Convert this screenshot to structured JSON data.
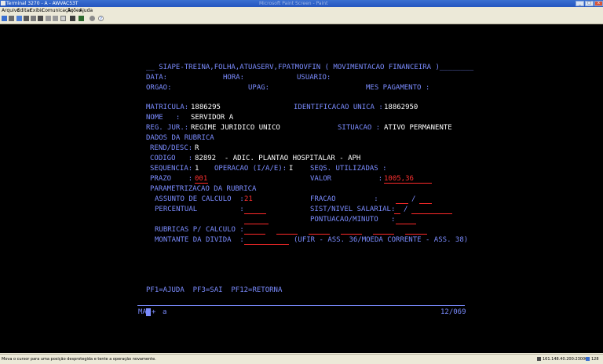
{
  "window": {
    "title": "Terminal 3270 - A - AWVAC53T",
    "ghost_title": "Microsoft Paint Screen - Paint"
  },
  "menu": [
    "Arquivo",
    "Editar",
    "Exibir",
    "Comunicação",
    "Ações",
    "Ajuda"
  ],
  "screen": {
    "header": "__ SIAPE-TREINA,FOLHA,ATUASERV,FPATMOVFIN ( MOVIMENTACAO FINANCEIRA )________",
    "data_label": "DATA:",
    "hora_label": "HORA:",
    "usuario_label": "USUARIO:",
    "orgao_label": "ORGAO:",
    "upag_label": "UPAG:",
    "mes_label": "MES PAGAMENTO :",
    "matricula_label": "MATRICULA:",
    "matricula": "1886295",
    "ident_label": "IDENTIFICACAO UNICA :",
    "ident": "18862950",
    "nome_label": "NOME   :",
    "nome": "SERVIDOR A",
    "regjur_label": "REG. JUR.:",
    "regjur": "REGIME JURIDICO UNICO",
    "situacao_label": "SITUACAO :",
    "situacao": "ATIVO PERMANENTE",
    "dados_label": "DADOS DA RUBRICA",
    "rend_label": "REND/DESC:",
    "rend": "R",
    "codigo_label": "CODIGO   :",
    "codigo": "82892  - ADIC. PLANTAO HOSPITALAR - APH",
    "sequencia_label": "SEQUENCIA:",
    "sequencia": "1",
    "operacao_label": "OPERACAO (I/A/E):",
    "operacao": "I",
    "seqs_label": "SEQS. UTILIZADAS :",
    "prazo_label": "PRAZO    :",
    "prazo": "001",
    "valor_label": "VALOR           :",
    "valor": "1005,36",
    "param_label": "PARAMETRIZACAO DA RUBRICA",
    "assunto_label": "ASSUNTO DE CALCULO  :",
    "assunto": "21",
    "fracao_label": "FRACAO         :",
    "fracao_sep": "/",
    "percentual_label": "PERCENTUAL          :",
    "sist_label": "SIST/NIVEL SALARIAL:",
    "sist_sep": "/",
    "pont_label": "PONTUACAO/MINUTO   :",
    "rubricas_label": "RUBRICAS P/ CALCULO :",
    "montante_label": "MONTANTE DA DIVIDA  :",
    "ufir": "(UFIR - ASS. 36/MOEDA CORRENTE - ASS. 38)",
    "pfkeys": "PF1=AJUDA  PF3=SAI  PF12=RETORNA",
    "oia_left": "MA",
    "oia_plus": "+",
    "oia_a": "a",
    "oia_right": "12/069"
  },
  "status": {
    "message": "Mova o cursor para uma posição desprotegida e tente a operação novamente.",
    "address": "161.148.40.200:23000",
    "session": "128"
  },
  "colors": {
    "field_label": "#7b8cff",
    "value": "#ffffff",
    "input": "#ff3030",
    "background": "#000000"
  }
}
